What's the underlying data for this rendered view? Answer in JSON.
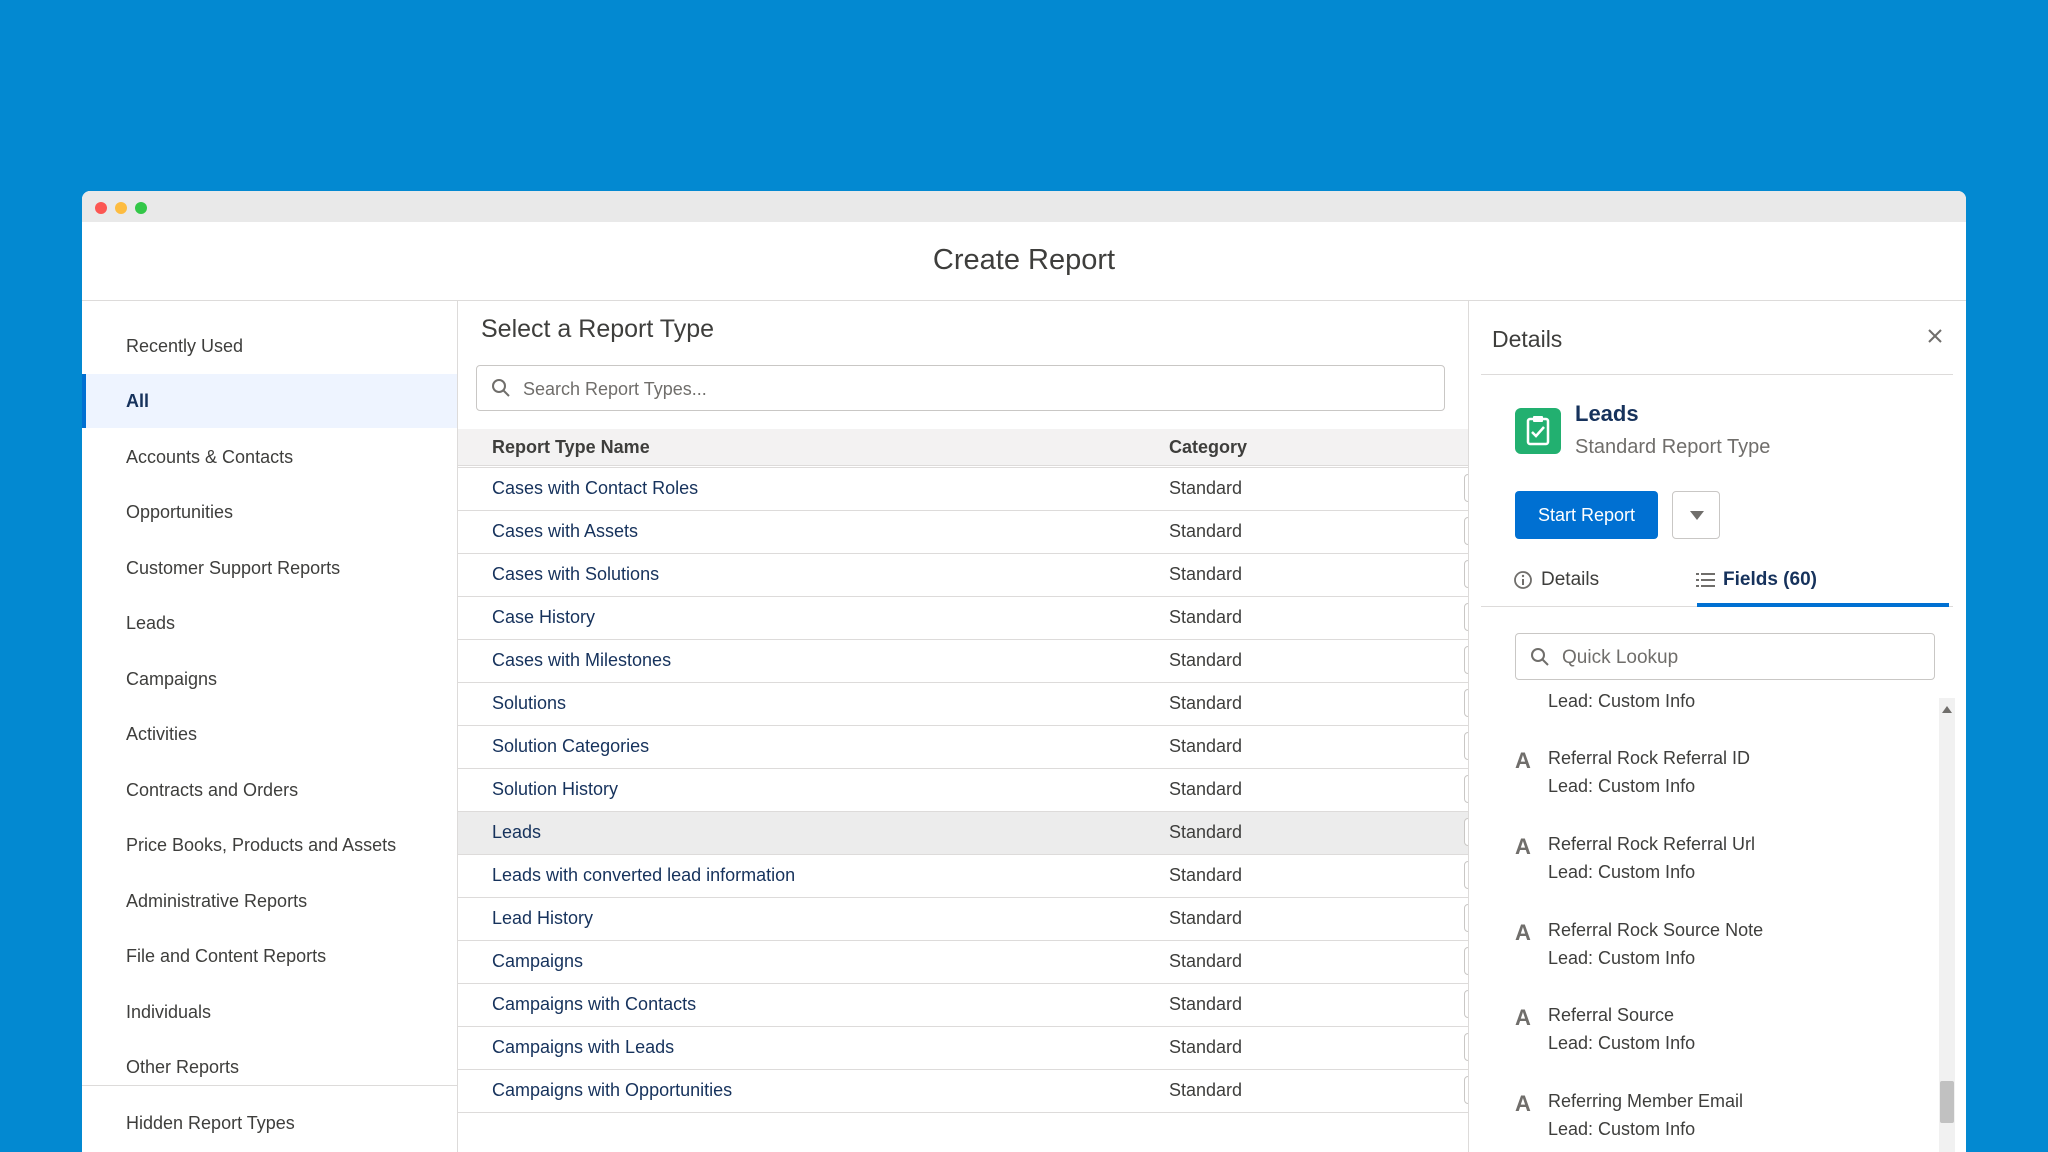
{
  "window": {
    "title": "Create Report"
  },
  "sidebar": {
    "items": [
      {
        "label": "Recently Used"
      },
      {
        "label": "All"
      },
      {
        "label": "Accounts & Contacts"
      },
      {
        "label": "Opportunities"
      },
      {
        "label": "Customer Support Reports"
      },
      {
        "label": "Leads"
      },
      {
        "label": "Campaigns"
      },
      {
        "label": "Activities"
      },
      {
        "label": "Contracts and Orders"
      },
      {
        "label": "Price Books, Products and Assets"
      },
      {
        "label": "Administrative Reports"
      },
      {
        "label": "File and Content Reports"
      },
      {
        "label": "Individuals"
      },
      {
        "label": "Other Reports"
      },
      {
        "label": "Hidden Report Types"
      }
    ],
    "active_index": 1
  },
  "main": {
    "title": "Select a Report Type",
    "search_placeholder": "Search Report Types...",
    "columns": {
      "name": "Report Type Name",
      "category": "Category"
    },
    "rows": [
      {
        "name": "Cases with Contact Roles",
        "category": "Standard"
      },
      {
        "name": "Cases with Assets",
        "category": "Standard"
      },
      {
        "name": "Cases with Solutions",
        "category": "Standard"
      },
      {
        "name": "Case History",
        "category": "Standard"
      },
      {
        "name": "Cases with Milestones",
        "category": "Standard"
      },
      {
        "name": "Solutions",
        "category": "Standard"
      },
      {
        "name": "Solution Categories",
        "category": "Standard"
      },
      {
        "name": "Solution History",
        "category": "Standard"
      },
      {
        "name": "Leads",
        "category": "Standard"
      },
      {
        "name": "Leads with converted lead information",
        "category": "Standard"
      },
      {
        "name": "Lead History",
        "category": "Standard"
      },
      {
        "name": "Campaigns",
        "category": "Standard"
      },
      {
        "name": "Campaigns with Contacts",
        "category": "Standard"
      },
      {
        "name": "Campaigns with Leads",
        "category": "Standard"
      },
      {
        "name": "Campaigns with Opportunities",
        "category": "Standard"
      }
    ],
    "selected_row": "Leads"
  },
  "details": {
    "title": "Details",
    "report_type_name": "Leads",
    "report_type_sub": "Standard Report Type",
    "start_label": "Start Report",
    "tab_details": "Details",
    "tab_fields": "Fields (60)",
    "lookup_placeholder": "Quick Lookup",
    "top_field_sub": "Lead: Custom Info",
    "fields": [
      {
        "name": "Referral Rock Referral ID",
        "sub": "Lead: Custom Info"
      },
      {
        "name": "Referral Rock Referral Url",
        "sub": "Lead: Custom Info"
      },
      {
        "name": "Referral Rock Source Note",
        "sub": "Lead: Custom Info"
      },
      {
        "name": "Referral Source",
        "sub": "Lead: Custom Info"
      },
      {
        "name": "Referring Member Email",
        "sub": "Lead: Custom Info"
      }
    ],
    "field_type_glyph": "A"
  },
  "colors": {
    "background": "#0389d1",
    "brand": "#0070d2",
    "link": "#16325c",
    "report_icon": "#22b070"
  },
  "icons": [
    "search-icon",
    "close-icon",
    "report-type-icon",
    "info-icon",
    "list-icon",
    "chevron-down-icon",
    "text-field-icon"
  ]
}
